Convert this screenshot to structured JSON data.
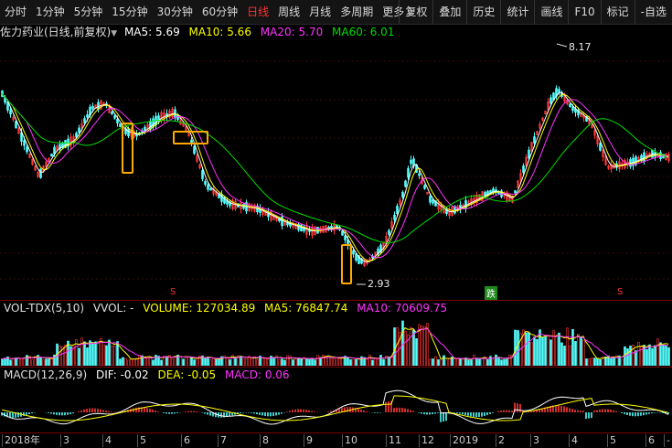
{
  "toolbar": {
    "periods": [
      "分时",
      "1分钟",
      "5分钟",
      "15分钟",
      "30分钟",
      "60分钟",
      "日线",
      "周线",
      "月线",
      "多周期",
      "更多 〉"
    ],
    "active_index": 6,
    "actions": [
      "复权",
      "叠加",
      "历史",
      "统计",
      "画线",
      "F10",
      "标记",
      "-自选"
    ]
  },
  "main_info": {
    "stock": "佐力药业(日线,前复权)",
    "dropdown_icon": "chevron-down-icon",
    "ma5": "MA5: 5.69",
    "ma10": "MA10: 5.66",
    "ma20": "MA20: 5.70",
    "ma60": "MA60: 6.01"
  },
  "annotations": {
    "high": "8.17",
    "low": "2.93"
  },
  "markers": {
    "s": "S",
    "fall": "跌"
  },
  "vol_info": {
    "name": "VOL-TDX(5,10)",
    "vvol": "VVOL: -",
    "volume": "VOLUME: 127034.89",
    "ma5": "MA5: 76847.74",
    "ma10": "MA10: 70609.75"
  },
  "macd_info": {
    "name": "MACD(12,26,9)",
    "dif": "DIF: -0.02",
    "dea": "DEA: -0.05",
    "macd": "MACD: 0.06"
  },
  "x_labels": [
    "2018年",
    "3",
    "4",
    "5",
    "6",
    "7",
    "8",
    "9",
    "10",
    "11",
    "12",
    "2019",
    "2",
    "3",
    "4",
    "5",
    "6",
    "--"
  ],
  "colors": {
    "up": "#ff3a3a",
    "down": "#54ffff",
    "ma5": "#ffffff",
    "ma10": "#ffff00",
    "ma20": "#ff33ff",
    "ma60": "#00dd00",
    "highlight": "#ffaa00"
  }
}
